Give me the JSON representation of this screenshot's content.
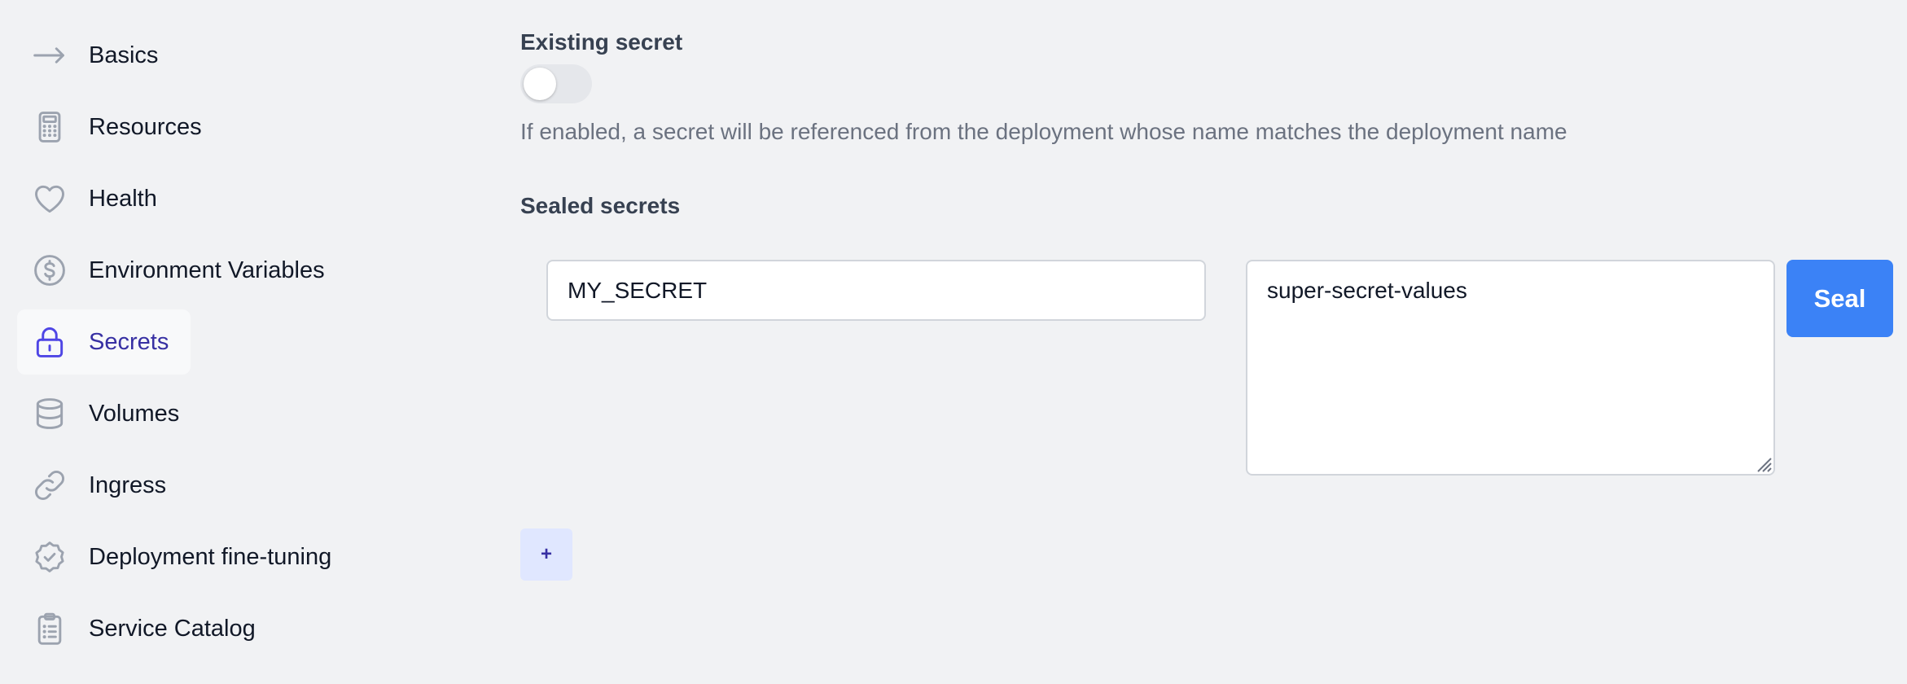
{
  "sidebar": {
    "items": [
      {
        "label": "Basics",
        "icon": "arrow-right-icon",
        "active": false
      },
      {
        "label": "Resources",
        "icon": "calculator-icon",
        "active": false
      },
      {
        "label": "Health",
        "icon": "heart-icon",
        "active": false
      },
      {
        "label": "Environment Variables",
        "icon": "currency-dollar-icon",
        "active": false
      },
      {
        "label": "Secrets",
        "icon": "lock-icon",
        "active": true
      },
      {
        "label": "Volumes",
        "icon": "database-icon",
        "active": false
      },
      {
        "label": "Ingress",
        "icon": "link-icon",
        "active": false
      },
      {
        "label": "Deployment fine-tuning",
        "icon": "badge-check-icon",
        "active": false
      },
      {
        "label": "Service Catalog",
        "icon": "clipboard-list-icon",
        "active": false
      }
    ]
  },
  "main": {
    "existing_secret": {
      "title": "Existing secret",
      "enabled": false,
      "help": "If enabled, a secret will be referenced from the deployment whose name matches the deployment name"
    },
    "sealed_secrets": {
      "title": "Sealed secrets",
      "key_value": "MY_SECRET",
      "secret_value": "super-secret-values",
      "seal_label": "Seal",
      "add_label": "+"
    }
  },
  "colors": {
    "background": "#f1f2f4",
    "accent": "#3b82f6",
    "active_nav_text": "#3730a3",
    "active_nav_icon": "#4f46e5",
    "icon_gray": "#9ca3af",
    "add_button_bg": "#e0e7ff"
  }
}
